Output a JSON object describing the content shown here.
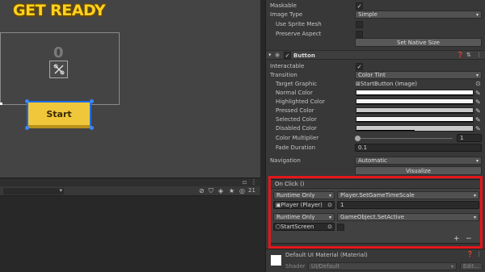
{
  "scene": {
    "title_text": "GET READY",
    "score_text": "0",
    "button_text": "Start"
  },
  "toolbar": {
    "icons": [
      "hide-icon",
      "bookmark-icon",
      "filter-icon",
      "pin-icon",
      "count-icon"
    ],
    "count_label": "21"
  },
  "image": {
    "maskable_label": "Maskable",
    "image_type_label": "Image Type",
    "image_type_value": "Simple",
    "use_sprite_mesh_label": "Use Sprite Mesh",
    "preserve_aspect_label": "Preserve Aspect",
    "set_native_size_label": "Set Native Size"
  },
  "button_component": {
    "title": "Button",
    "interactable_label": "Interactable",
    "transition_label": "Transition",
    "transition_value": "Color Tint",
    "target_graphic_label": "Target Graphic",
    "target_graphic_value": "StartButton (Image)",
    "normal_color_label": "Normal Color",
    "highlighted_color_label": "Highlighted Color",
    "pressed_color_label": "Pressed Color",
    "selected_color_label": "Selected Color",
    "disabled_color_label": "Disabled Color",
    "color_multiplier_label": "Color Multiplier",
    "color_multiplier_value": "1",
    "fade_duration_label": "Fade Duration",
    "fade_duration_value": "0.1",
    "navigation_label": "Navigation",
    "navigation_value": "Automatic",
    "visualize_label": "Visualize",
    "colors": {
      "normal": "#ffffff",
      "highlighted": "#f5f5f5",
      "pressed": "#c8c8c8",
      "selected": "#f5f5f5",
      "disabled": "#c8c8c8"
    }
  },
  "on_click": {
    "title": "On Click ()",
    "entries": [
      {
        "mode": "Runtime Only",
        "function": "Player.SetGameTimeScale",
        "target": "Player (Player)",
        "argument": "1"
      },
      {
        "mode": "Runtime Only",
        "function": "GameObject.SetActive",
        "target": "StartScreen",
        "argument": ""
      }
    ],
    "add_label": "+",
    "remove_label": "−"
  },
  "material": {
    "name": "Default UI Material (Material)",
    "shader_label": "Shader",
    "shader_value": "UI/Default",
    "edit_label": "Edit..."
  },
  "colors": {
    "highlight": "#e4161a",
    "accent": "#ffd21f"
  }
}
